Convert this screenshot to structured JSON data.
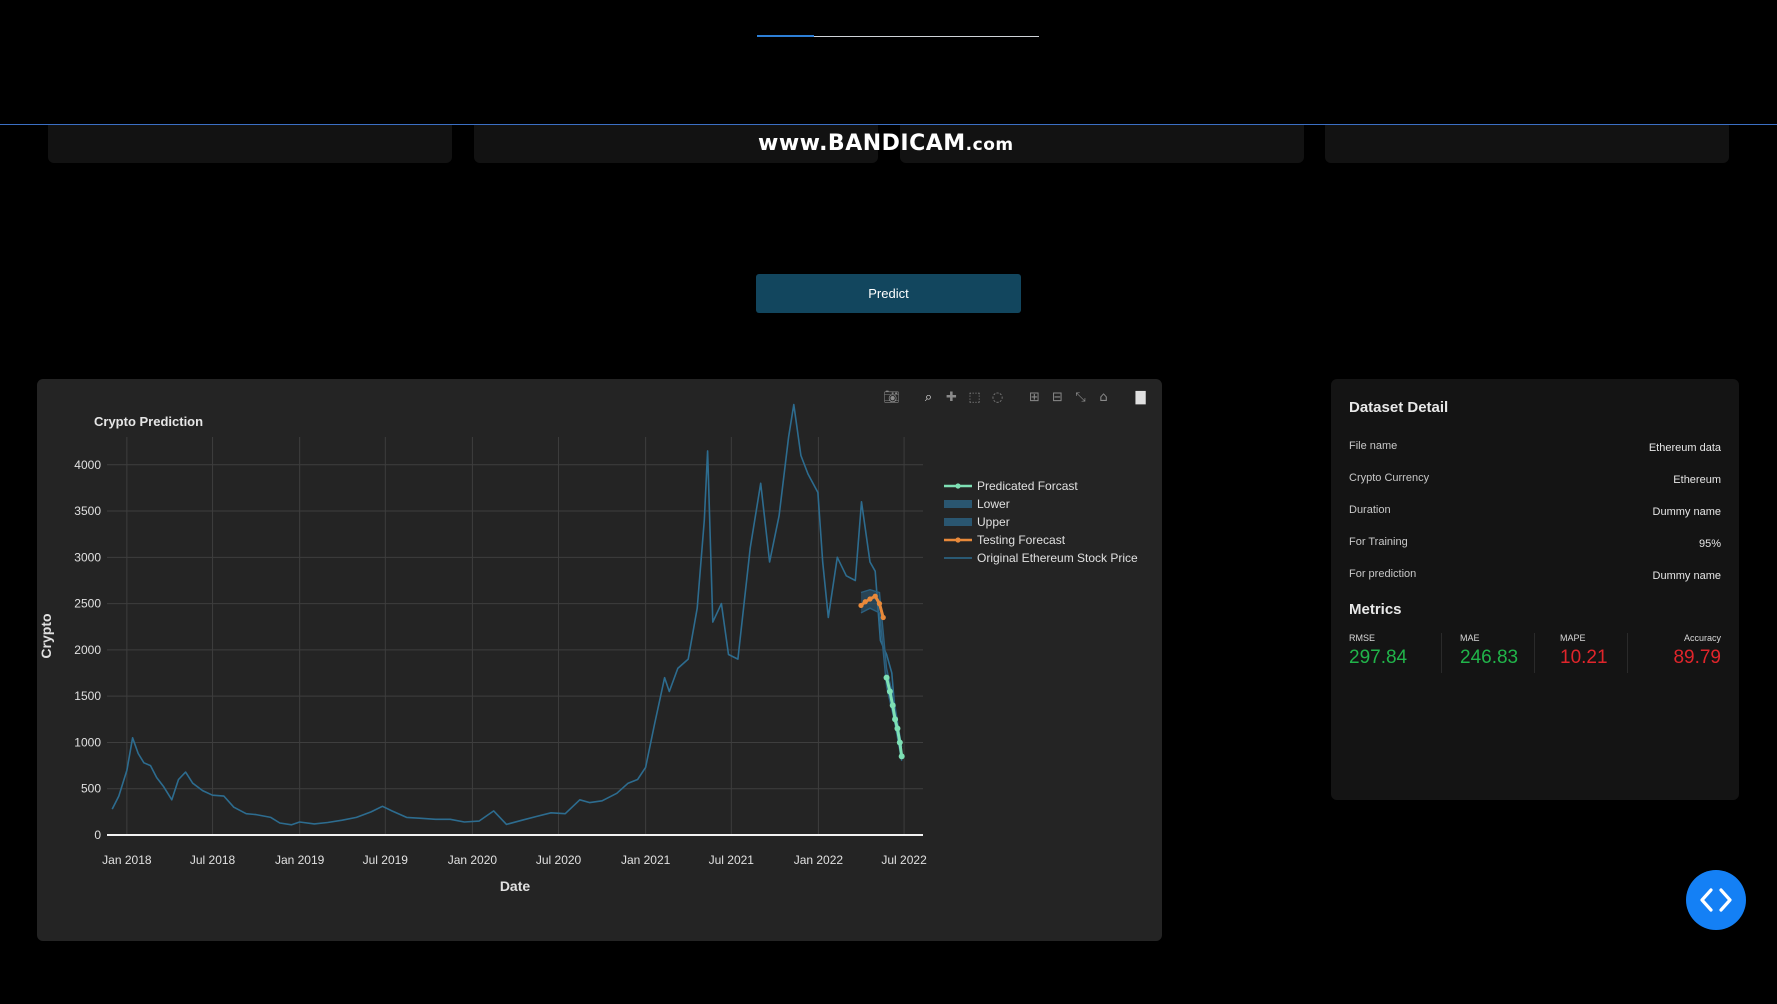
{
  "watermark": {
    "main": "www.BANDICAM",
    "suffix": ".com"
  },
  "predict_button": {
    "label": "Predict"
  },
  "chart_card": {
    "modebar_icons": [
      "camera-icon",
      "zoom-icon",
      "pan-icon",
      "box-select-icon",
      "lasso-select-icon",
      "zoom-in-icon",
      "zoom-out-icon",
      "autoscale-icon",
      "reset-axes-icon",
      "plotly-logo-icon"
    ]
  },
  "chart_data": {
    "type": "line",
    "title": "Crypto Prediction",
    "xlabel": "Date",
    "ylabel": "Crypto",
    "x_ticks": [
      "Jan 2018",
      "Jul 2018",
      "Jan 2019",
      "Jul 2019",
      "Jan 2020",
      "Jul 2020",
      "Jan 2021",
      "Jul 2021",
      "Jan 2022",
      "Jul 2022"
    ],
    "y_ticks": [
      0,
      500,
      1000,
      1500,
      2000,
      2500,
      3000,
      3500,
      4000
    ],
    "ylim": [
      0,
      4300
    ],
    "grid": true,
    "legend_position": "right",
    "legend": [
      "Predicated Forcast",
      "Lower",
      "Upper",
      "Testing Forecast",
      "Original Ethereum Stock Price"
    ],
    "colors": {
      "predicated": "#7ee0b4",
      "lower": "#2b5f7e",
      "upper": "#2b5f7e",
      "testing": "#e8893a",
      "original": "#2d6c8f"
    },
    "series": [
      {
        "name": "Original Ethereum Stock Price",
        "x": [
          "2017-12-01",
          "2017-12-15",
          "2018-01-01",
          "2018-01-13",
          "2018-01-25",
          "2018-02-06",
          "2018-02-20",
          "2018-03-05",
          "2018-03-20",
          "2018-04-06",
          "2018-04-20",
          "2018-05-05",
          "2018-05-20",
          "2018-06-10",
          "2018-07-01",
          "2018-07-25",
          "2018-08-15",
          "2018-09-10",
          "2018-10-01",
          "2018-11-01",
          "2018-11-20",
          "2018-12-15",
          "2019-01-01",
          "2019-02-01",
          "2019-03-01",
          "2019-04-01",
          "2019-05-01",
          "2019-06-01",
          "2019-06-25",
          "2019-07-15",
          "2019-08-15",
          "2019-09-15",
          "2019-10-15",
          "2019-11-15",
          "2019-12-15",
          "2020-01-15",
          "2020-02-15",
          "2020-03-13",
          "2020-04-15",
          "2020-05-15",
          "2020-06-15",
          "2020-07-15",
          "2020-08-15",
          "2020-09-05",
          "2020-10-01",
          "2020-11-01",
          "2020-11-25",
          "2020-12-15",
          "2021-01-01",
          "2021-01-20",
          "2021-02-10",
          "2021-02-20",
          "2021-03-10",
          "2021-04-01",
          "2021-04-20",
          "2021-05-05",
          "2021-05-12",
          "2021-05-23",
          "2021-06-10",
          "2021-06-25",
          "2021-07-15",
          "2021-08-10",
          "2021-09-01",
          "2021-09-20",
          "2021-10-10",
          "2021-10-30",
          "2021-11-10",
          "2021-11-25",
          "2021-12-10",
          "2021-12-31",
          "2022-01-10",
          "2022-01-22",
          "2022-02-10",
          "2022-03-01",
          "2022-03-20",
          "2022-04-02",
          "2022-04-20",
          "2022-05-01",
          "2022-05-12",
          "2022-05-25",
          "2022-06-05",
          "2022-06-14"
        ],
        "values": [
          280,
          420,
          700,
          1050,
          880,
          780,
          750,
          620,
          520,
          380,
          600,
          680,
          560,
          480,
          430,
          420,
          300,
          230,
          220,
          190,
          130,
          110,
          140,
          120,
          135,
          160,
          190,
          250,
          310,
          260,
          190,
          180,
          170,
          170,
          140,
          150,
          260,
          115,
          160,
          200,
          240,
          230,
          380,
          350,
          370,
          450,
          560,
          600,
          730,
          1200,
          1700,
          1550,
          1800,
          1900,
          2450,
          3400,
          4150,
          2300,
          2500,
          1950,
          1900,
          3100,
          3800,
          2950,
          3450,
          4300,
          4650,
          4100,
          3900,
          3700,
          2950,
          2350,
          3000,
          2800,
          2750,
          3600,
          2950,
          2850,
          2100,
          1950,
          1750,
          1200
        ]
      },
      {
        "name": "Testing Forecast",
        "x": [
          "2022-04-01",
          "2022-04-10",
          "2022-04-20",
          "2022-05-01",
          "2022-05-10",
          "2022-05-18"
        ],
        "values": [
          2480,
          2520,
          2550,
          2580,
          2500,
          2350
        ]
      },
      {
        "name": "Predicated Forcast",
        "x": [
          "2022-05-25",
          "2022-06-01",
          "2022-06-07",
          "2022-06-12",
          "2022-06-17",
          "2022-06-22",
          "2022-06-26"
        ],
        "values": [
          1700,
          1550,
          1400,
          1250,
          1150,
          1000,
          850
        ]
      },
      {
        "name": "Lower",
        "x": [
          "2022-04-01",
          "2022-04-20",
          "2022-05-10",
          "2022-05-25",
          "2022-06-10",
          "2022-06-26"
        ],
        "values": [
          2400,
          2450,
          2400,
          1600,
          1250,
          800
        ]
      },
      {
        "name": "Upper",
        "x": [
          "2022-04-01",
          "2022-04-20",
          "2022-05-10",
          "2022-05-25",
          "2022-06-10",
          "2022-06-26"
        ],
        "values": [
          2620,
          2650,
          2620,
          1800,
          1450,
          950
        ]
      }
    ]
  },
  "dataset_detail": {
    "title": "Dataset Detail",
    "rows": [
      {
        "label": "File name",
        "value": "Ethereum data"
      },
      {
        "label": "Crypto Currency",
        "value": "Ethereum"
      },
      {
        "label": "Duration",
        "value": "Dummy name"
      },
      {
        "label": "For Training",
        "value": "95%"
      },
      {
        "label": "For prediction",
        "value": "Dummy name"
      }
    ]
  },
  "metrics": {
    "title": "Metrics",
    "items": [
      {
        "label": "RMSE",
        "value": "297.84",
        "color": "#21b44a"
      },
      {
        "label": "MAE",
        "value": "246.83",
        "color": "#21b44a"
      },
      {
        "label": "MAPE",
        "value": "10.21",
        "color": "#e0252b"
      },
      {
        "label": "Accuracy",
        "value": "89.79",
        "color": "#e0252b"
      }
    ]
  },
  "fab": {
    "icon": "code-icon"
  }
}
